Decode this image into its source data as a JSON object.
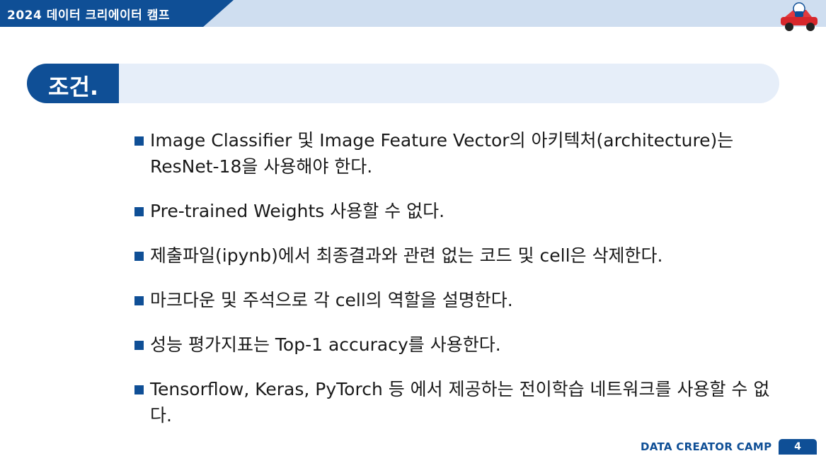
{
  "header": {
    "title": "2024 데이터 크리에이터 캠프",
    "mascot_icon": "race-car-mascot-icon"
  },
  "section": {
    "heading": "조건."
  },
  "bullets": [
    "Image Classifier 및 Image Feature Vector의 아키텍처(architecture)는 ResNet-18을 사용해야 한다.",
    "Pre-trained Weights 사용할 수 없다.",
    "제출파일(ipynb)에서 최종결과와 관련 없는 코드 및 cell은 삭제한다.",
    "마크다운 및 주석으로 각 cell의 역할을 설명한다.",
    "성능 평가지표는 Top-1 accuracy를 사용한다.",
    "Tensorflow, Keras, PyTorch 등 에서 제공하는 전이학습 네트워크를 사용할 수 없다."
  ],
  "footer": {
    "label": "DATA CREATOR CAMP",
    "page_number": "4"
  },
  "colors": {
    "brand_blue": "#0f4f96",
    "light_blue": "#cfdef0",
    "heading_bar": "#e6eef9"
  }
}
